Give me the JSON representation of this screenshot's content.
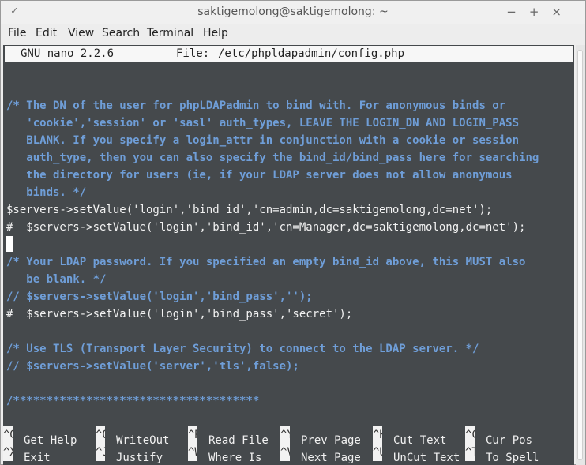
{
  "window": {
    "title": "saktigemolong@saktigemolong: ~",
    "left_glyph": "✓",
    "controls": [
      "−",
      "+",
      "×"
    ]
  },
  "menu": [
    "File",
    "Edit",
    "View",
    "Search",
    "Terminal",
    "Help"
  ],
  "nano_header": {
    "version": "GNU nano 2.2.6",
    "file_label": "File:",
    "file_path": "/etc/phpldapadmin/config.php"
  },
  "editor_lines": [
    {
      "text": "/* The DN of the user for phpLDAPadmin to bind with. For anonymous binds or",
      "kind": "comment"
    },
    {
      "text": "   'cookie','session' or 'sasl' auth_types, LEAVE THE LOGIN_DN AND LOGIN_PASS",
      "kind": "comment"
    },
    {
      "text": "   BLANK. If you specify a login_attr in conjunction with a cookie or session",
      "kind": "comment"
    },
    {
      "text": "   auth_type, then you can also specify the bind_id/bind_pass here for searching",
      "kind": "comment"
    },
    {
      "text": "   the directory for users (ie, if your LDAP server does not allow anonymous",
      "kind": "comment"
    },
    {
      "text": "   binds. */",
      "kind": "comment"
    },
    {
      "text": "$servers->setValue('login','bind_id','cn=admin,dc=saktigemolong,dc=net');",
      "kind": "code"
    },
    {
      "text": "#  $servers->setValue('login','bind_id','cn=Manager,dc=saktigemolong,dc=net');",
      "kind": "code"
    },
    {
      "text": "",
      "kind": "cursor"
    },
    {
      "text": "/* Your LDAP password. If you specified an empty bind_id above, this MUST also",
      "kind": "comment"
    },
    {
      "text": "   be blank. */",
      "kind": "comment"
    },
    {
      "text": "// $servers->setValue('login','bind_pass','');",
      "kind": "comment"
    },
    {
      "text": "#  $servers->setValue('login','bind_pass','secret');",
      "kind": "code"
    },
    {
      "text": "",
      "kind": "blank"
    },
    {
      "text": "/* Use TLS (Transport Layer Security) to connect to the LDAP server. */",
      "kind": "comment"
    },
    {
      "text": "// $servers->setValue('server','tls',false);",
      "kind": "comment"
    },
    {
      "text": "",
      "kind": "blank"
    },
    {
      "text": "/*************************************",
      "kind": "comment"
    }
  ],
  "shortcuts_row1": [
    {
      "key": "^G",
      "label": "Get Help"
    },
    {
      "key": "^O",
      "label": "WriteOut"
    },
    {
      "key": "^R",
      "label": "Read File"
    },
    {
      "key": "^Y",
      "label": "Prev Page"
    },
    {
      "key": "^K",
      "label": "Cut Text"
    },
    {
      "key": "^C",
      "label": "Cur Pos"
    }
  ],
  "shortcuts_row2": [
    {
      "key": "^X",
      "label": "Exit"
    },
    {
      "key": "^J",
      "label": "Justify"
    },
    {
      "key": "^W",
      "label": "Where Is"
    },
    {
      "key": "^V",
      "label": "Next Page"
    },
    {
      "key": "^U",
      "label": "UnCut Text"
    },
    {
      "key": "^T",
      "label": "To Spell"
    }
  ]
}
